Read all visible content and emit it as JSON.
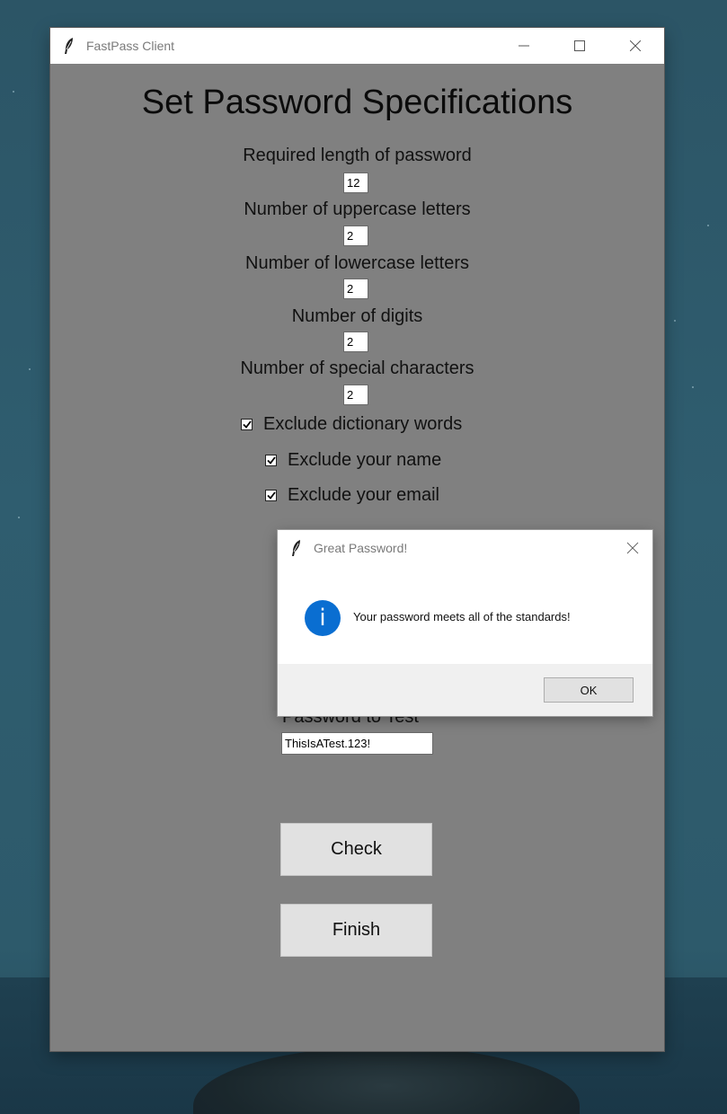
{
  "window": {
    "title": "FastPass Client",
    "heading": "Set Password Specifications"
  },
  "fields": [
    {
      "label": "Required length of password",
      "value": "12"
    },
    {
      "label": "Number of uppercase letters",
      "value": "2"
    },
    {
      "label": "Number of lowercase letters",
      "value": "2"
    },
    {
      "label": "Number of digits",
      "value": "2"
    },
    {
      "label": "Number of special characters",
      "value": "2"
    }
  ],
  "options": [
    {
      "label": "Exclude dictionary words",
      "checked": true
    },
    {
      "label": "Exclude your name",
      "checked": true
    },
    {
      "label": "Exclude your email",
      "checked": true
    }
  ],
  "password": {
    "label": "Password to Test",
    "value": "ThisIsATest.123!"
  },
  "buttons": {
    "check": "Check",
    "finish": "Finish"
  },
  "dialog": {
    "title": "Great Password!",
    "message": "Your password meets all of the standards!",
    "ok": "OK",
    "icon": "info-icon"
  },
  "colors": {
    "window_bg": "#808080",
    "dialog_info": "#0a6ed1"
  }
}
